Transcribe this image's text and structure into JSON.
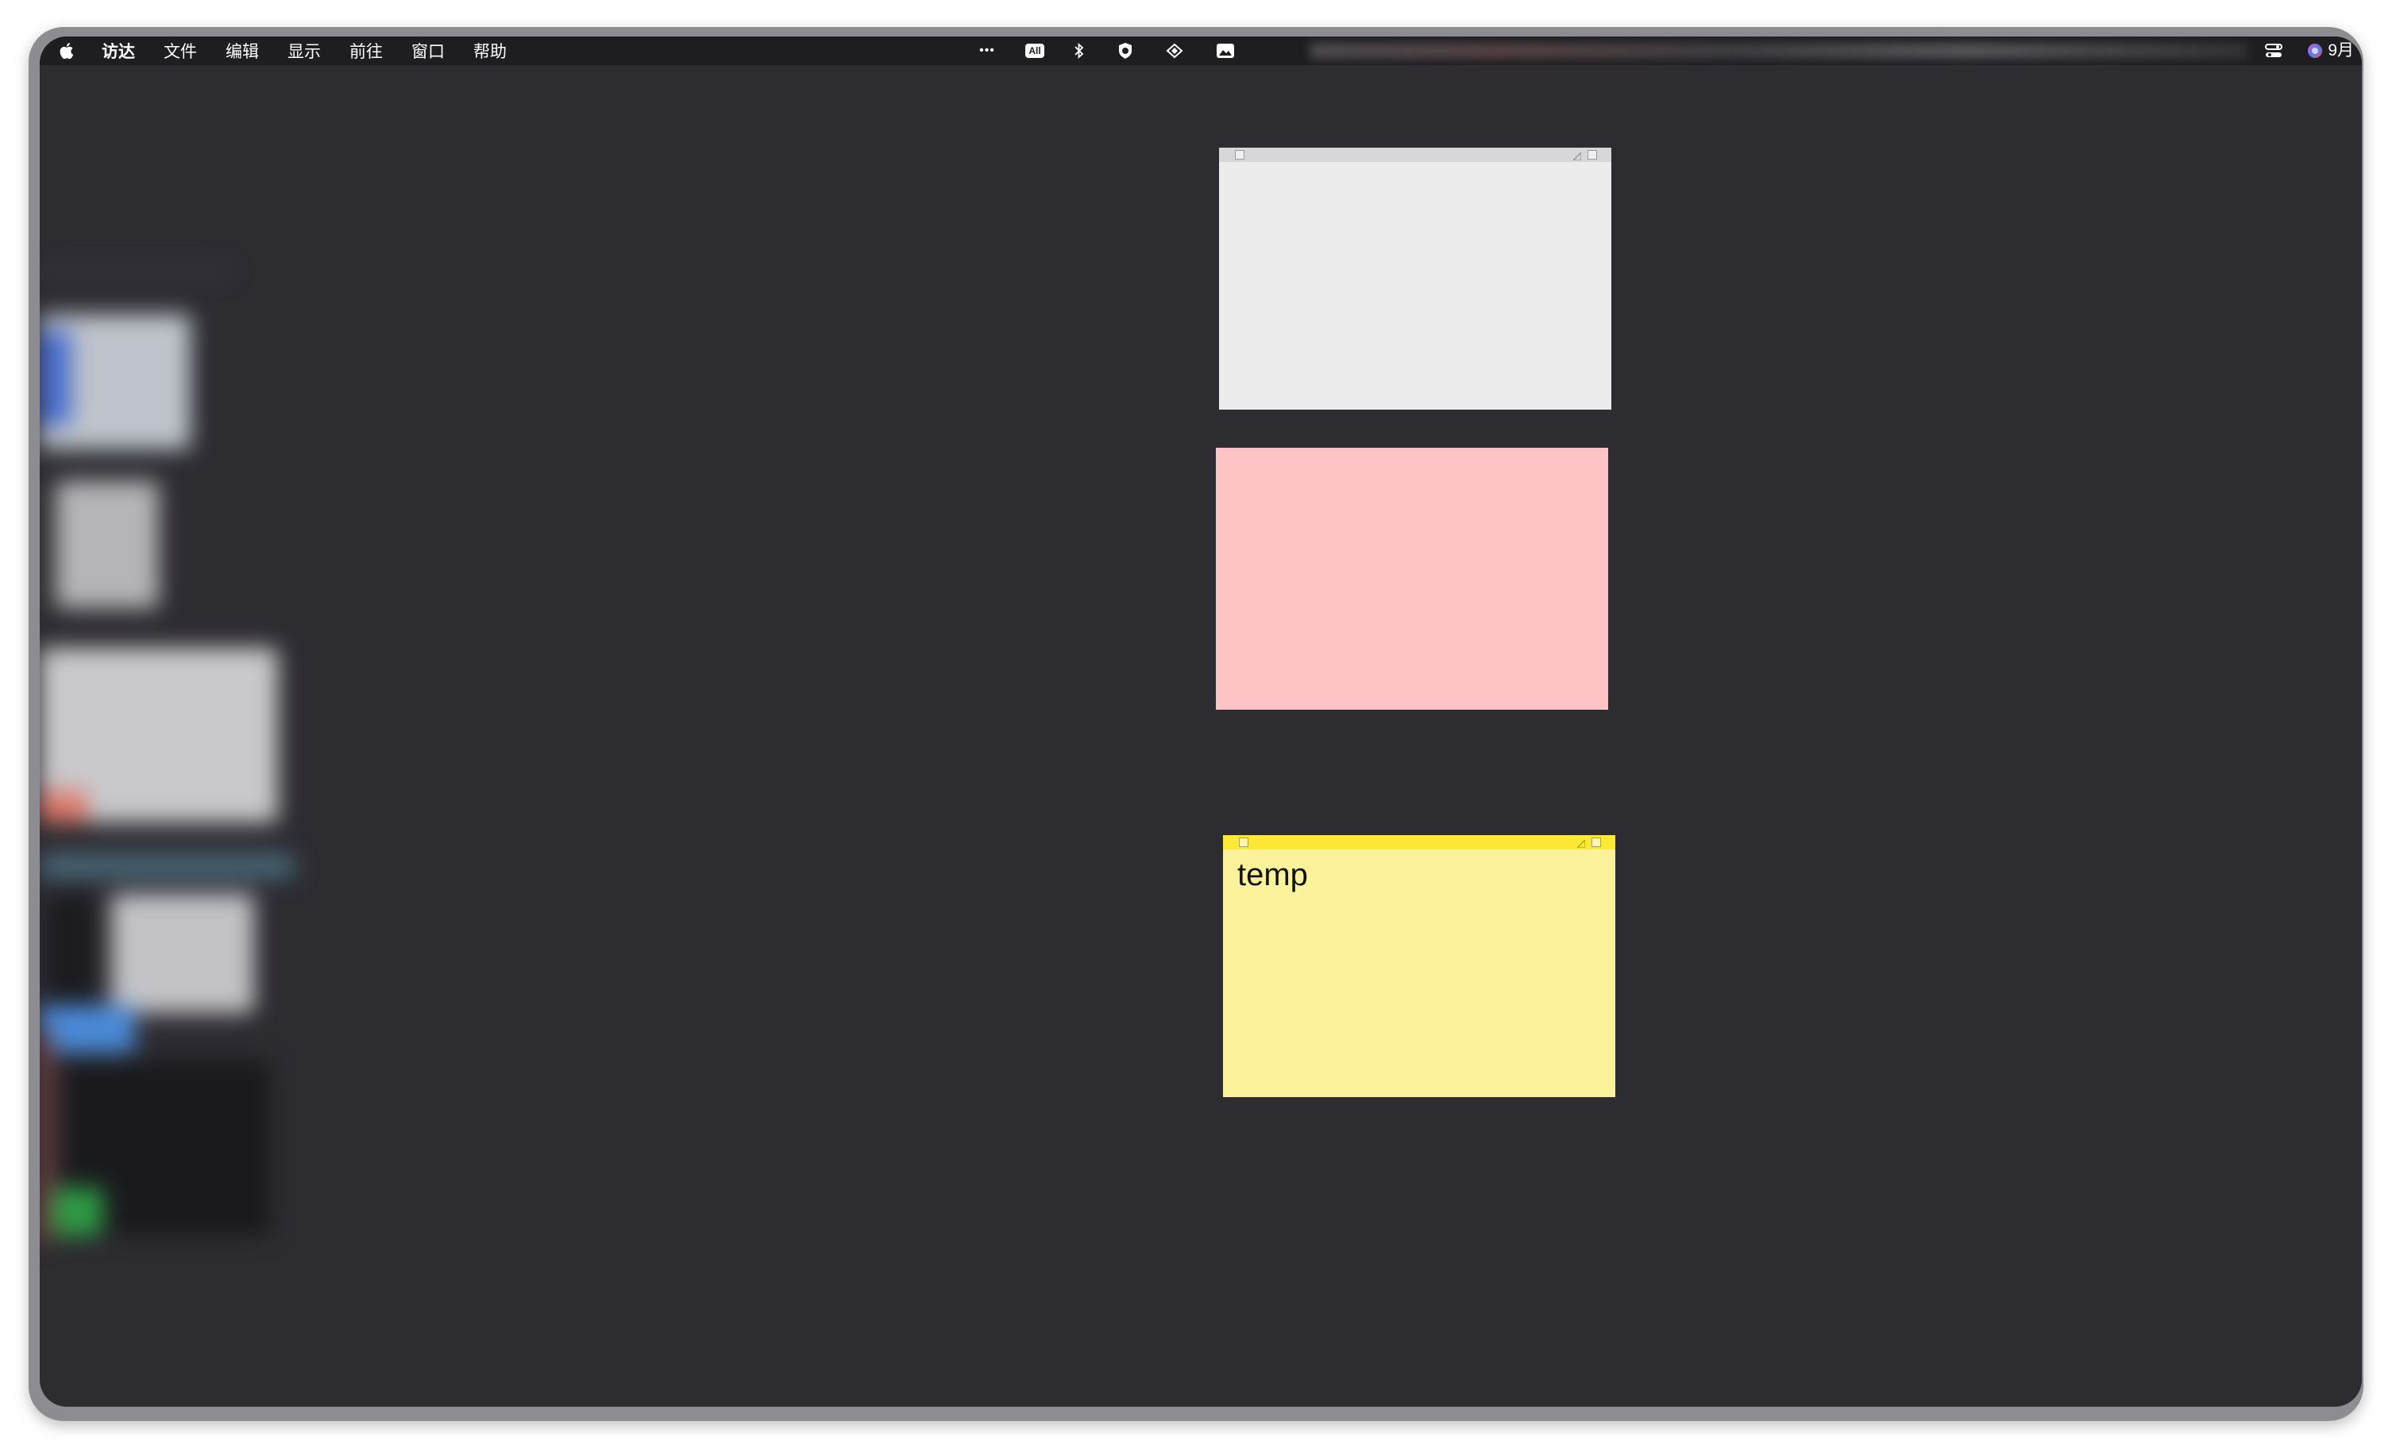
{
  "menubar": {
    "app_name": "访达",
    "menus": [
      "文件",
      "编辑",
      "显示",
      "前往",
      "窗口",
      "帮助"
    ],
    "status_icons": [
      "more-icon",
      "input-method-icon",
      "bluetooth-icon",
      "shield-icon",
      "sync-icon",
      "image-icon",
      "control-center-icon",
      "siri-icon"
    ],
    "input_method_label": "All",
    "more_label": "•••",
    "clock": "9月"
  },
  "stickies": [
    {
      "color_name": "gray",
      "color": "#ececec",
      "text": ""
    },
    {
      "color_name": "pink",
      "color": "#fec4c5",
      "text": ""
    },
    {
      "color_name": "yellow",
      "color": "#fdf29c",
      "text": "temp"
    }
  ],
  "colors": {
    "desktop": "#2d2c31",
    "menubar": "#1e1e21",
    "yellow_titlebar": "#fde833",
    "gray_titlebar": "#d7d7d7"
  }
}
